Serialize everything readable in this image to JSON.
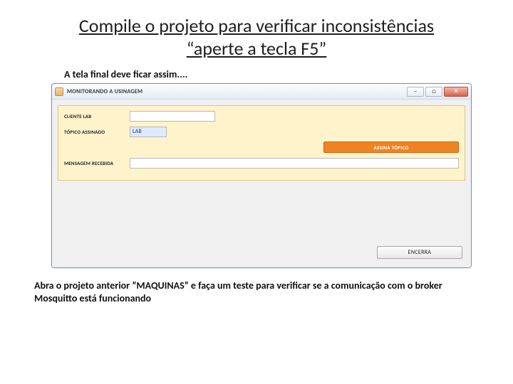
{
  "title": {
    "line1": "Compile o projeto para verificar inconsistências",
    "line2": "“aperte a tecla F5”"
  },
  "subtitle": "A tela final deve  ficar assim....",
  "window": {
    "title": "MONITORANDO A USINAGEM",
    "panel": {
      "client_label": "CLIENTE LAB",
      "topic_label": "TÓPICO ASSINADO",
      "topic_value": "LAB",
      "subscribe_button": "ASSINA TÓPICO",
      "message_label": "MENSAGEM RECEBIDA"
    },
    "close_button": "ENCERRA"
  },
  "footer": "Abra o projeto anterior “MAQUINAS” e faça um teste para verificar se a comunicação com o broker Mosquitto está funcionando"
}
